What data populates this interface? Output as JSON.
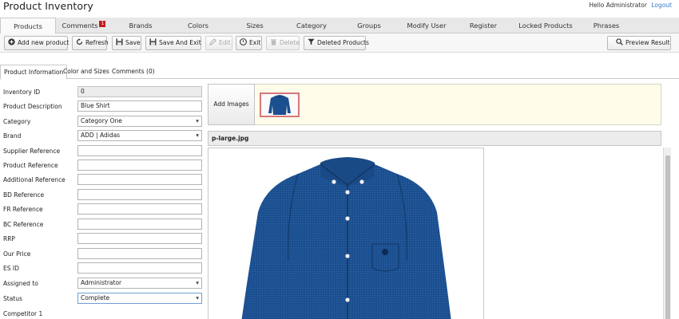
{
  "app": {
    "title": "Product Inventory",
    "greeting": "Hello Administrator",
    "logout_label": "Logout"
  },
  "nav": {
    "tabs": [
      {
        "label": "Products",
        "active": true
      },
      {
        "label": "Comments",
        "badge": "1"
      },
      {
        "label": "Brands"
      },
      {
        "label": "Colors"
      },
      {
        "label": "Sizes"
      },
      {
        "label": "Category"
      },
      {
        "label": "Groups"
      },
      {
        "label": "Modify User"
      },
      {
        "label": "Register"
      },
      {
        "label": "Locked Products"
      },
      {
        "label": "Phrases"
      }
    ]
  },
  "toolbar": {
    "add_new_product": "Add new product",
    "refresh": "Refresh",
    "save": "Save",
    "save_and_exit": "Save And Exit",
    "edit": "Edit",
    "exit": "Exit",
    "delete": "Delete",
    "deleted_products": "Deleted Products",
    "preview_result": "Preview Result"
  },
  "sub_tabs": {
    "product_information": "Product Information",
    "color_and_sizes": "Color and Sizes",
    "comments": "Comments (0)"
  },
  "form": {
    "fields": [
      {
        "label": "Inventory ID",
        "value": "0"
      },
      {
        "label": "Product Description",
        "value": "Blue Shirt"
      },
      {
        "label": "Category",
        "value": "Category One"
      },
      {
        "label": "Brand",
        "value": "ADD | Adidas"
      },
      {
        "label": "Supplier Reference",
        "value": ""
      },
      {
        "label": "Product Reference",
        "value": ""
      },
      {
        "label": "Additional Reference",
        "value": ""
      },
      {
        "label": "BD Reference",
        "value": ""
      },
      {
        "label": "FR Reference",
        "value": ""
      },
      {
        "label": "BC Reference",
        "value": ""
      },
      {
        "label": "RRP",
        "value": ""
      },
      {
        "label": "Our Price",
        "value": ""
      },
      {
        "label": "ES ID",
        "value": ""
      },
      {
        "label": "Assigned to",
        "value": "Administrator"
      },
      {
        "label": "Status",
        "value": "Complete"
      },
      {
        "label": "Competitor 1",
        "value": ""
      }
    ]
  },
  "images": {
    "add_images_label": "Add Images",
    "selected_filename": "p-large.jpg"
  },
  "colors": {
    "shirt": "#1b4f8f",
    "shirt_dark": "#133a6b",
    "badge": "#c51d1d",
    "thumb_border": "#d9757a",
    "panel_bg": "#fdfdea"
  }
}
